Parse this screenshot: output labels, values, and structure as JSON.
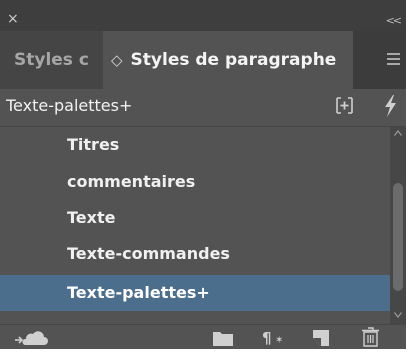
{
  "window": {
    "close_glyph": "×",
    "collapse_glyph": "<<"
  },
  "tabs": [
    {
      "label": "Styles de caractère",
      "shown_text": "Styles c",
      "active": false
    },
    {
      "label": "Styles de paragraphe",
      "active": true,
      "chevron": "◇"
    }
  ],
  "panel_menu_icon": "hamburger-icon",
  "header": {
    "title": "Texte-palettes+",
    "new_group_icon": "new-style-group-icon",
    "clear_overrides_icon": "lightning-icon"
  },
  "styles": [
    {
      "label": "Titres",
      "selected": false
    },
    {
      "label": "commentaires",
      "selected": false
    },
    {
      "label": "Texte",
      "selected": false
    },
    {
      "label": "Texte-commandes",
      "selected": false
    },
    {
      "label": "Texte-palettes+",
      "selected": true
    }
  ],
  "bottom_icons": [
    "cloud-library-icon",
    "folder-icon",
    "clear-overrides-icon",
    "new-style-icon",
    "trash-icon"
  ],
  "colors": {
    "panel_bg": "#535353",
    "selection": "#4b6e8c",
    "tab_bar": "#3c3c3c"
  }
}
